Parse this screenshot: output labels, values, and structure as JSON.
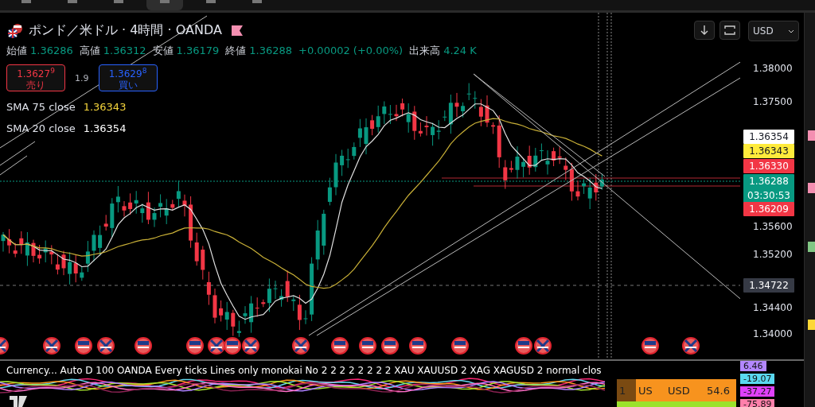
{
  "toolbar": {
    "buttons": [
      {
        "selected": false
      },
      {
        "selected": false
      },
      {
        "selected": false
      },
      {
        "selected": true
      },
      {
        "selected": false
      },
      {
        "selected": false
      }
    ]
  },
  "symbol": {
    "title": "ポンド／米ドル · 4時間 · OANDA"
  },
  "ohlc": [
    {
      "label": "始値",
      "value": "1.36286"
    },
    {
      "label": "高値",
      "value": "1.36312"
    },
    {
      "label": "安値",
      "value": "1.36179"
    },
    {
      "label": "終値",
      "value": "1.36288"
    }
  ],
  "change": "+0.00002 (+0.00%)",
  "volume": {
    "label": "出来高",
    "value": "4.24 K"
  },
  "trade": {
    "sell": {
      "price": "1.3627$^{9}$",
      "label": "売り"
    },
    "spread": "1.9",
    "buy": {
      "price": "1.3629$^{8}$",
      "label": "買い"
    }
  },
  "indicators": [
    {
      "name": "SMA 75 close",
      "value": "1.36343",
      "color": "#f5d53c"
    },
    {
      "name": "SMA 20 close",
      "value": "1.36354",
      "color": "#ffffff"
    }
  ],
  "currency": "USD",
  "price_axis": {
    "ticks": [
      "1.38000",
      "1.37500",
      "1.35600",
      "1.35200",
      "1.34400",
      "1.34000"
    ],
    "tags": [
      {
        "value": "1.36354",
        "color": "#ffffff"
      },
      {
        "value": "1.36343",
        "color": "#ffeb3b"
      },
      {
        "value": "1.36330",
        "color": "#f23645"
      },
      {
        "value": "1.36288",
        "countdown": "03:30:53",
        "color": "#089981"
      },
      {
        "value": "1.36209",
        "color": "#f23645"
      },
      {
        "value": "1.34722",
        "color": "#363a45"
      }
    ]
  },
  "bottom": {
    "legend": "Currency... Auto D 100 OANDA Every ticks Lines only monokai No 2 2 2 2 2 2 2 2 XAU XAUUSD 2 XAG XAGUSD 2 normal clos",
    "table": [
      "1",
      "US",
      "USD",
      "54.6"
    ],
    "tags": [
      {
        "value": "6.46",
        "color": "#b388ff"
      },
      {
        "value": "-19.07",
        "color": "#5ad8f0"
      },
      {
        "value": "-37.27",
        "color": "#e040fb"
      },
      {
        "value": "-75.89",
        "color": "#ff80ab"
      }
    ]
  }
}
